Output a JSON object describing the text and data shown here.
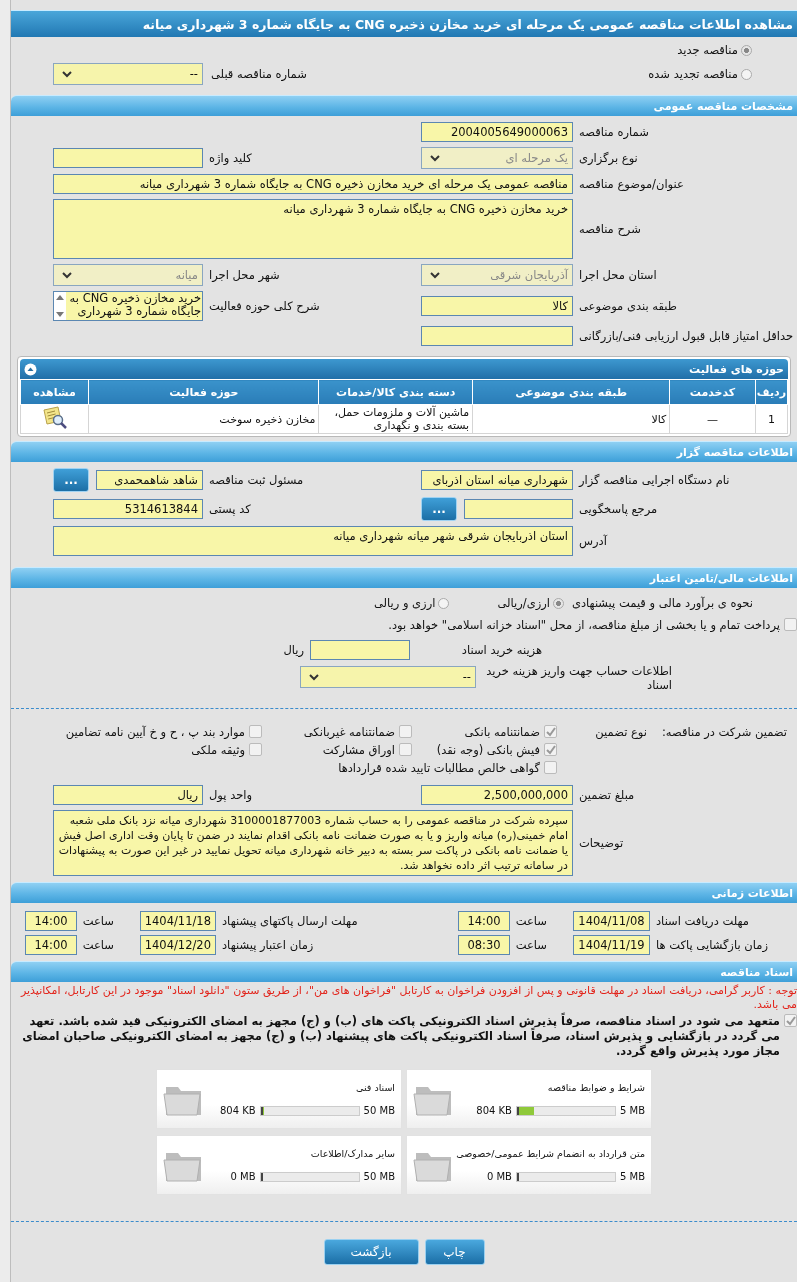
{
  "title": "مشاهده اطلاعات مناقصه عمومی یک مرحله ای خرید مخازن ذخیره CNG به جایگاه شماره 3 شهرداری میانه",
  "tender_status": [
    {
      "label": "مناقصه جدید",
      "selected": true
    },
    {
      "label": "مناقصه تجدید شده",
      "selected": false
    }
  ],
  "previous_tender": {
    "label": "شماره مناقصه قبلی",
    "kind": "select",
    "value": "--",
    "disabled": false
  },
  "general": {
    "heading": "مشخصات مناقصه عمومی",
    "rows": [
      [
        {
          "label": "شماره مناقصه",
          "kind": "text",
          "value": "2004005649000063"
        }
      ],
      [
        {
          "label": "نوع برگزاری",
          "kind": "select",
          "value": "یک مرحله ای",
          "disabled": true
        },
        {
          "label": "کلید واژه",
          "kind": "text"
        }
      ],
      [
        {
          "label": "عنوان/موضوع مناقصه",
          "kind": "wide",
          "value": "مناقصه عمومی یک مرحله ای خرید مخازن ذخیره CNG به جایگاه شماره 3 شهرداری میانه"
        }
      ],
      [
        {
          "label": "شرح مناقصه",
          "kind": "textarea",
          "value": "خرید مخازن ذخیره CNG به جایگاه شماره 3 شهرداری میانه"
        }
      ],
      [
        {
          "label": "استان محل اجرا",
          "kind": "select",
          "value": "آذربایجان شرقی",
          "disabled": true
        },
        {
          "label": "شهر محل اجرا",
          "kind": "select",
          "value": "میانه",
          "disabled": true
        }
      ],
      [
        {
          "label": "طبقه بندی موضوعی",
          "kind": "text",
          "value": "کالا"
        },
        {
          "label": "شرح کلی حوزه فعالیت",
          "kind": "listbox",
          "value": "خرید مخازن ذخیره CNG به جایگاه شماره 3 شهرداری"
        }
      ],
      [
        {
          "label": "حداقل امتیاز قابل قبول ارزیابی فنی/بازرگانی",
          "kind": "text"
        }
      ]
    ]
  },
  "activities": {
    "heading": "حوزه های فعالیت",
    "columns": [
      "ردیف",
      "کدخدمت",
      "طبقه بندی موضوعی",
      "دسته بندی کالا/خدمات",
      "حوزه فعالیت",
      "مشاهده"
    ],
    "rows": [
      {
        "cells": [
          "1",
          "—",
          "کالا",
          "ماشین آلات و ملزومات حمل، بسته بندی و نگهداری",
          "مخازن ذخیره سوخت"
        ]
      }
    ]
  },
  "organizer": {
    "heading": "اطلاعات مناقصه گزار",
    "rows": [
      [
        {
          "label": "نام دستگاه اجرایی مناقصه گزار",
          "kind": "text",
          "value": "شهرداری میانه استان اذربای"
        },
        {
          "label": "مسئول ثبت مناقصه",
          "kind": "text",
          "value": "شاهد شاهمحمدی",
          "button": "..."
        }
      ],
      [
        {
          "label": "مرجع پاسخگویی",
          "kind": "text",
          "button": "..."
        },
        {
          "label": "کد پستی",
          "kind": "text",
          "value": "5314613844"
        }
      ],
      [
        {
          "label": "آدرس",
          "kind": "textarea",
          "value": "استان اذربایجان شرقی شهر میانه شهرداری میانه"
        }
      ]
    ]
  },
  "finance": {
    "heading": "اطلاعات مالی/تامین اعتبار",
    "estimate": {
      "label": "نحوه ی برآورد مالی و قیمت پیشنهادی",
      "options": [
        {
          "label": "ارزی/ریالی",
          "selected": true
        },
        {
          "label": "ارزی و ریالی",
          "selected": false
        }
      ]
    },
    "treasury": {
      "label": "پرداخت تمام و یا بخشی از مبلغ مناقصه، از محل \"اسناد خزانه اسلامی\" خواهد بود.",
      "checked": false
    },
    "document_cost": {
      "label": "هزینه خرید اسناد",
      "unit": "ریال"
    },
    "account": {
      "label": "اطلاعات حساب جهت واریز هزینه خرید اسناد",
      "value": "--",
      "disabled": false
    }
  },
  "guarantee": {
    "label": "تضمین شرکت در مناقصه:",
    "type_label": "نوع تضمین",
    "options": [
      {
        "label": "ضمانتنامه بانکی",
        "checked": true
      },
      {
        "label": "ضمانتنامه غیربانکی",
        "checked": false
      },
      {
        "label": "موارد بند پ ، ح و خ آیین نامه تضامین",
        "checked": false
      },
      {
        "label": "فیش بانکی (وجه نقد)",
        "checked": true
      },
      {
        "label": "اوراق مشارکت",
        "checked": false
      },
      {
        "label": "وثیقه ملکی",
        "checked": false
      },
      {
        "label": "گواهی خالص مطالبات تایید شده قراردادها",
        "checked": false
      }
    ],
    "rows": [
      [
        {
          "label": "مبلغ تضمین",
          "kind": "text",
          "value": "2,500,000,000"
        },
        {
          "label": "واحد پول",
          "kind": "text",
          "value": "ریال"
        }
      ],
      [
        {
          "label": "توضیحات",
          "kind": "textarea",
          "value": "سپرده شرکت در مناقصه عمومی را به حساب شماره 3100001877003 شهرداری میانه نزد بانک ملی شعبه امام خمینی(ره) میانه واریز و یا به صورت ضمانت نامه بانکی اقدام نمایند در ضمن تا پایان وقت اداری اصل فیش یا ضمانت نامه بانکی در پاکت سر بسته به دبیر خانه شهرداری میانه تحویل نمایید در غیر این صورت به پیشنهادات در سامانه ترتیب اثر داده نخواهد شد."
        }
      ]
    ]
  },
  "schedule": {
    "heading": "اطلاعات زمانی",
    "items": [
      {
        "label": "مهلت دریافت اسناد",
        "date": "1404/11/08",
        "time_label": "ساعت",
        "time": "14:00"
      },
      {
        "label": "مهلت ارسال پاکتهای پیشنهاد",
        "date": "1404/11/18",
        "time_label": "ساعت",
        "time": "14:00"
      },
      {
        "label": "زمان بازگشایی پاکت ها",
        "date": "1404/11/19",
        "time_label": "ساعت",
        "time": "08:30"
      },
      {
        "label": "زمان اعتبار پیشنهاد",
        "date": "1404/12/20",
        "time_label": "ساعت",
        "time": "14:00"
      }
    ]
  },
  "documents": {
    "heading": "اسناد مناقصه",
    "notice": "توجه : کاربر گرامی، دریافت اسناد در مهلت قانونی و پس از افزودن فراخوان به کارتابل \"فراخوان های من\"، از طریق ستون \"دانلود اسناد\" موجود در این کارتابل، امکانپذیر می باشد.",
    "commitment": {
      "text": "متعهد می شود در اسناد مناقصه، صرفاً پذیرش اسناد الکترونیکی پاکت های (ب) و (ج) مجهز به امضای الکترونیکی قید شده باشد. تعهد می گردد در بازگشایی و پذیرش اسناد، صرفاً اسناد الکترونیکی پاکت های پیشنهاد (ب) و (ج) مجهز به امضای الکترونیکی صاحبان امضای مجاز مورد پذیرش واقع گردد.",
      "checked": true
    },
    "files": [
      {
        "name": "شرایط و ضوابط مناقصه",
        "used": "804 KB",
        "max": "5 MB",
        "level": 0.157
      },
      {
        "name": "اسناد فنی",
        "used": "804 KB",
        "max": "50 MB",
        "level": 0.016
      },
      {
        "name": "متن قرارداد به انضمام شرایط عمومی/خصوصی",
        "used": "0 MB",
        "max": "5 MB",
        "level": 0
      },
      {
        "name": "سایر مدارک/اطلاعات",
        "used": "0 MB",
        "max": "50 MB",
        "level": 0
      }
    ]
  },
  "buttons": [
    {
      "label": "چاپ"
    },
    {
      "label": "بازگشت"
    }
  ]
}
